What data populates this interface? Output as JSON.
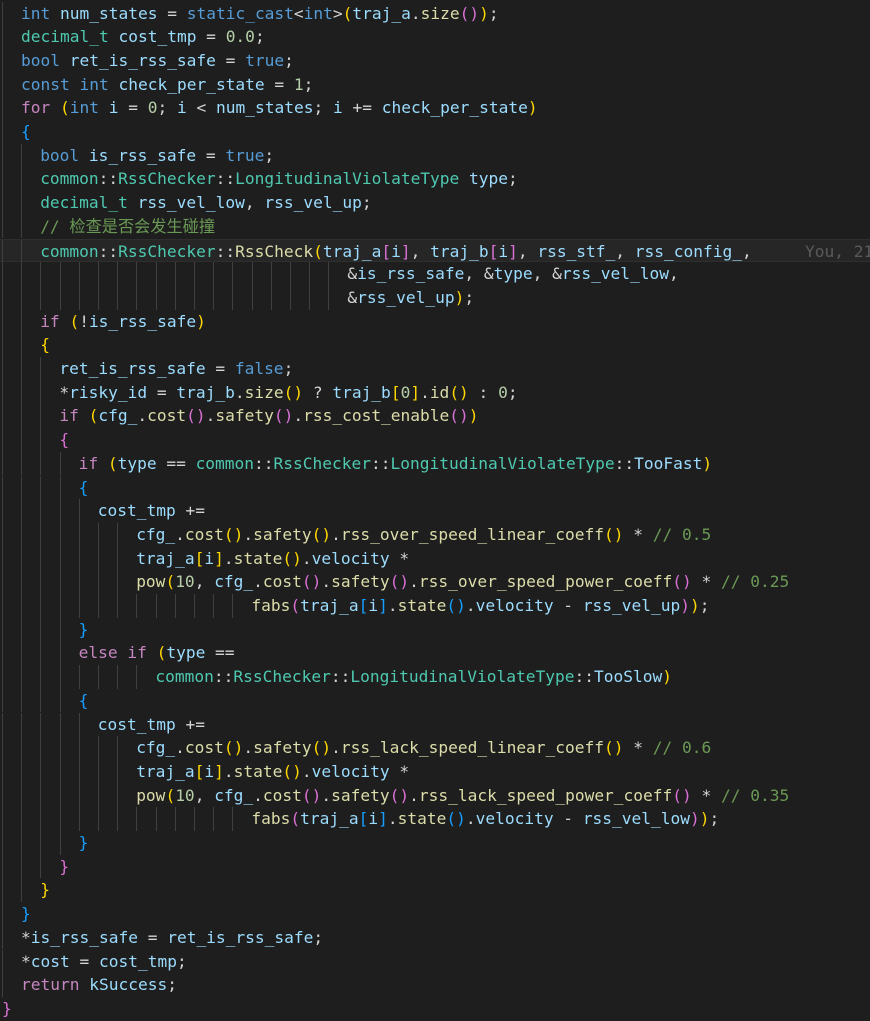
{
  "lines": [
    {
      "ind": 1,
      "t": [
        [
          "int",
          "kw"
        ],
        [
          " ",
          ""
        ],
        [
          "num_states",
          "var"
        ],
        [
          " = ",
          ""
        ],
        [
          "static_cast",
          "kw"
        ],
        [
          "<",
          "op"
        ],
        [
          "int",
          "kw"
        ],
        [
          ">",
          "op"
        ],
        [
          "(",
          "p1"
        ],
        [
          "traj_a",
          "var"
        ],
        [
          ".",
          ""
        ],
        [
          "size",
          "fn"
        ],
        [
          "()",
          "p2"
        ],
        [
          ")",
          "p1"
        ],
        [
          ";",
          ""
        ]
      ]
    },
    {
      "ind": 1,
      "t": [
        [
          "decimal_t",
          "ty"
        ],
        [
          " ",
          ""
        ],
        [
          "cost_tmp",
          "var"
        ],
        [
          " = ",
          ""
        ],
        [
          "0.0",
          "num"
        ],
        [
          ";",
          ""
        ]
      ]
    },
    {
      "ind": 1,
      "t": [
        [
          "bool",
          "kw"
        ],
        [
          " ",
          ""
        ],
        [
          "ret_is_rss_safe",
          "var"
        ],
        [
          " = ",
          ""
        ],
        [
          "true",
          "lit"
        ],
        [
          ";",
          ""
        ]
      ]
    },
    {
      "ind": 1,
      "t": [
        [
          "const",
          "kw"
        ],
        [
          " ",
          ""
        ],
        [
          "int",
          "kw"
        ],
        [
          " ",
          ""
        ],
        [
          "check_per_state",
          "var"
        ],
        [
          " = ",
          ""
        ],
        [
          "1",
          "num"
        ],
        [
          ";",
          ""
        ]
      ]
    },
    {
      "ind": 1,
      "t": [
        [
          "for",
          "ctl"
        ],
        [
          " ",
          ""
        ],
        [
          "(",
          "p1"
        ],
        [
          "int",
          "kw"
        ],
        [
          " ",
          ""
        ],
        [
          "i",
          "var"
        ],
        [
          " = ",
          ""
        ],
        [
          "0",
          "num"
        ],
        [
          "; ",
          ""
        ],
        [
          "i",
          "var"
        ],
        [
          " < ",
          ""
        ],
        [
          "num_states",
          "var"
        ],
        [
          "; ",
          ""
        ],
        [
          "i",
          "var"
        ],
        [
          " += ",
          ""
        ],
        [
          "check_per_state",
          "var"
        ],
        [
          ")",
          "p1"
        ]
      ]
    },
    {
      "ind": 1,
      "t": [
        [
          "{",
          "p3"
        ]
      ]
    },
    {
      "ind": 2,
      "t": [
        [
          "bool",
          "kw"
        ],
        [
          " ",
          ""
        ],
        [
          "is_rss_safe",
          "var"
        ],
        [
          " = ",
          ""
        ],
        [
          "true",
          "lit"
        ],
        [
          ";",
          ""
        ]
      ]
    },
    {
      "ind": 2,
      "t": [
        [
          "common",
          "ty"
        ],
        [
          "::",
          ""
        ],
        [
          "RssChecker",
          "ty"
        ],
        [
          "::",
          ""
        ],
        [
          "LongitudinalViolateType",
          "ty"
        ],
        [
          " ",
          ""
        ],
        [
          "type",
          "var"
        ],
        [
          ";",
          ""
        ]
      ]
    },
    {
      "ind": 2,
      "t": [
        [
          "decimal_t",
          "ty"
        ],
        [
          " ",
          ""
        ],
        [
          "rss_vel_low",
          "var"
        ],
        [
          ", ",
          ""
        ],
        [
          "rss_vel_up",
          "var"
        ],
        [
          ";",
          ""
        ]
      ]
    },
    {
      "ind": 2,
      "t": [
        [
          "// 检查是否会发生碰撞",
          "cm"
        ]
      ]
    },
    {
      "ind": 2,
      "current": true,
      "blame": "You, 21",
      "t": [
        [
          "common",
          "ty"
        ],
        [
          "::",
          ""
        ],
        [
          "RssChecker",
          "ty"
        ],
        [
          "::",
          ""
        ],
        [
          "RssCheck",
          "fn"
        ],
        [
          "(",
          "p1"
        ],
        [
          "traj_a",
          "var"
        ],
        [
          "[",
          "p2"
        ],
        [
          "i",
          "var"
        ],
        [
          "]",
          "p2"
        ],
        [
          ", ",
          ""
        ],
        [
          "traj_b",
          "var"
        ],
        [
          "[",
          "p2"
        ],
        [
          "i",
          "var"
        ],
        [
          "]",
          "p2"
        ],
        [
          ", ",
          ""
        ],
        [
          "rss_stf_",
          "var"
        ],
        [
          ", ",
          ""
        ],
        [
          "rss_config_",
          "var"
        ],
        [
          ",",
          ""
        ]
      ]
    },
    {
      "ind": 2,
      "cont": 16,
      "t": [
        [
          "&",
          ""
        ],
        [
          "is_rss_safe",
          "var"
        ],
        [
          ", &",
          ""
        ],
        [
          "type",
          "var"
        ],
        [
          ", &",
          ""
        ],
        [
          "rss_vel_low",
          "var"
        ],
        [
          ",",
          ""
        ]
      ]
    },
    {
      "ind": 2,
      "cont": 16,
      "t": [
        [
          "&",
          ""
        ],
        [
          "rss_vel_up",
          "var"
        ],
        [
          ")",
          "p1"
        ],
        [
          ";",
          ""
        ]
      ]
    },
    {
      "ind": 2,
      "t": [
        [
          "if",
          "ctl"
        ],
        [
          " ",
          ""
        ],
        [
          "(",
          "p1"
        ],
        [
          "!",
          ""
        ],
        [
          "is_rss_safe",
          "var"
        ],
        [
          ")",
          "p1"
        ]
      ]
    },
    {
      "ind": 2,
      "t": [
        [
          "{",
          "p1"
        ]
      ]
    },
    {
      "ind": 3,
      "t": [
        [
          "ret_is_rss_safe",
          "var"
        ],
        [
          " = ",
          ""
        ],
        [
          "false",
          "lit"
        ],
        [
          ";",
          ""
        ]
      ]
    },
    {
      "ind": 3,
      "t": [
        [
          "*",
          ""
        ],
        [
          "risky_id",
          "var"
        ],
        [
          " = ",
          ""
        ],
        [
          "traj_b",
          "var"
        ],
        [
          ".",
          ""
        ],
        [
          "size",
          "fn"
        ],
        [
          "()",
          "p1"
        ],
        [
          " ? ",
          ""
        ],
        [
          "traj_b",
          "var"
        ],
        [
          "[",
          "p1"
        ],
        [
          "0",
          "num"
        ],
        [
          "]",
          "p1"
        ],
        [
          ".",
          ""
        ],
        [
          "id",
          "fn"
        ],
        [
          "()",
          "p1"
        ],
        [
          " : ",
          ""
        ],
        [
          "0",
          "num"
        ],
        [
          ";",
          ""
        ]
      ]
    },
    {
      "ind": 3,
      "t": [
        [
          "if",
          "ctl"
        ],
        [
          " ",
          ""
        ],
        [
          "(",
          "p1"
        ],
        [
          "cfg_",
          "var"
        ],
        [
          ".",
          ""
        ],
        [
          "cost",
          "fn"
        ],
        [
          "()",
          "p2"
        ],
        [
          ".",
          ""
        ],
        [
          "safety",
          "fn"
        ],
        [
          "()",
          "p2"
        ],
        [
          ".",
          ""
        ],
        [
          "rss_cost_enable",
          "fn"
        ],
        [
          "()",
          "p2"
        ],
        [
          ")",
          "p1"
        ]
      ]
    },
    {
      "ind": 3,
      "t": [
        [
          "{",
          "p2"
        ]
      ]
    },
    {
      "ind": 4,
      "t": [
        [
          "if",
          "ctl"
        ],
        [
          " ",
          ""
        ],
        [
          "(",
          "p1"
        ],
        [
          "type",
          "var"
        ],
        [
          " == ",
          ""
        ],
        [
          "common",
          "ty"
        ],
        [
          "::",
          ""
        ],
        [
          "RssChecker",
          "ty"
        ],
        [
          "::",
          ""
        ],
        [
          "LongitudinalViolateType",
          "ty"
        ],
        [
          "::",
          ""
        ],
        [
          "TooFast",
          "var"
        ],
        [
          ")",
          "p1"
        ]
      ]
    },
    {
      "ind": 4,
      "t": [
        [
          "{",
          "p3"
        ]
      ]
    },
    {
      "ind": 5,
      "t": [
        [
          "cost_tmp",
          "var"
        ],
        [
          " +=",
          ""
        ]
      ]
    },
    {
      "ind": 5,
      "cont": 2,
      "t": [
        [
          "cfg_",
          "var"
        ],
        [
          ".",
          ""
        ],
        [
          "cost",
          "fn"
        ],
        [
          "()",
          "p1"
        ],
        [
          ".",
          ""
        ],
        [
          "safety",
          "fn"
        ],
        [
          "()",
          "p1"
        ],
        [
          ".",
          ""
        ],
        [
          "rss_over_speed_linear_coeff",
          "fn"
        ],
        [
          "()",
          "p1"
        ],
        [
          " * ",
          ""
        ],
        [
          "// 0.5",
          "cm"
        ]
      ]
    },
    {
      "ind": 5,
      "cont": 2,
      "t": [
        [
          "traj_a",
          "var"
        ],
        [
          "[",
          "p1"
        ],
        [
          "i",
          "var"
        ],
        [
          "]",
          "p1"
        ],
        [
          ".",
          ""
        ],
        [
          "state",
          "fn"
        ],
        [
          "()",
          "p1"
        ],
        [
          ".",
          ""
        ],
        [
          "velocity",
          "var"
        ],
        [
          " *",
          ""
        ]
      ]
    },
    {
      "ind": 5,
      "cont": 2,
      "t": [
        [
          "pow",
          "fn"
        ],
        [
          "(",
          "p1"
        ],
        [
          "10",
          "num"
        ],
        [
          ", ",
          ""
        ],
        [
          "cfg_",
          "var"
        ],
        [
          ".",
          ""
        ],
        [
          "cost",
          "fn"
        ],
        [
          "()",
          "p2"
        ],
        [
          ".",
          ""
        ],
        [
          "safety",
          "fn"
        ],
        [
          "()",
          "p2"
        ],
        [
          ".",
          ""
        ],
        [
          "rss_over_speed_power_coeff",
          "fn"
        ],
        [
          "()",
          "p2"
        ],
        [
          " * ",
          ""
        ],
        [
          "// 0.25",
          "cm"
        ]
      ]
    },
    {
      "ind": 5,
      "cont": 8,
      "t": [
        [
          "fabs",
          "fn"
        ],
        [
          "(",
          "p2"
        ],
        [
          "traj_a",
          "var"
        ],
        [
          "[",
          "p3"
        ],
        [
          "i",
          "var"
        ],
        [
          "]",
          "p3"
        ],
        [
          ".",
          ""
        ],
        [
          "state",
          "fn"
        ],
        [
          "()",
          "p3"
        ],
        [
          ".",
          ""
        ],
        [
          "velocity",
          "var"
        ],
        [
          " - ",
          ""
        ],
        [
          "rss_vel_up",
          "var"
        ],
        [
          ")",
          "p2"
        ],
        [
          ")",
          "p1"
        ],
        [
          ";",
          ""
        ]
      ]
    },
    {
      "ind": 4,
      "t": [
        [
          "}",
          "p3"
        ]
      ]
    },
    {
      "ind": 4,
      "t": [
        [
          "else",
          "ctl"
        ],
        [
          " ",
          ""
        ],
        [
          "if",
          "ctl"
        ],
        [
          " ",
          ""
        ],
        [
          "(",
          "p1"
        ],
        [
          "type",
          "var"
        ],
        [
          " ==",
          ""
        ]
      ]
    },
    {
      "ind": 4,
      "cont": 4,
      "t": [
        [
          "common",
          "ty"
        ],
        [
          "::",
          ""
        ],
        [
          "RssChecker",
          "ty"
        ],
        [
          "::",
          ""
        ],
        [
          "LongitudinalViolateType",
          "ty"
        ],
        [
          "::",
          ""
        ],
        [
          "TooSlow",
          "var"
        ],
        [
          ")",
          "p1"
        ]
      ]
    },
    {
      "ind": 4,
      "t": [
        [
          "{",
          "p3"
        ]
      ]
    },
    {
      "ind": 5,
      "t": [
        [
          "cost_tmp",
          "var"
        ],
        [
          " +=",
          ""
        ]
      ]
    },
    {
      "ind": 5,
      "cont": 2,
      "t": [
        [
          "cfg_",
          "var"
        ],
        [
          ".",
          ""
        ],
        [
          "cost",
          "fn"
        ],
        [
          "()",
          "p1"
        ],
        [
          ".",
          ""
        ],
        [
          "safety",
          "fn"
        ],
        [
          "()",
          "p1"
        ],
        [
          ".",
          ""
        ],
        [
          "rss_lack_speed_linear_coeff",
          "fn"
        ],
        [
          "()",
          "p1"
        ],
        [
          " * ",
          ""
        ],
        [
          "// 0.6",
          "cm"
        ]
      ]
    },
    {
      "ind": 5,
      "cont": 2,
      "t": [
        [
          "traj_a",
          "var"
        ],
        [
          "[",
          "p1"
        ],
        [
          "i",
          "var"
        ],
        [
          "]",
          "p1"
        ],
        [
          ".",
          ""
        ],
        [
          "state",
          "fn"
        ],
        [
          "()",
          "p1"
        ],
        [
          ".",
          ""
        ],
        [
          "velocity",
          "var"
        ],
        [
          " *",
          ""
        ]
      ]
    },
    {
      "ind": 5,
      "cont": 2,
      "t": [
        [
          "pow",
          "fn"
        ],
        [
          "(",
          "p1"
        ],
        [
          "10",
          "num"
        ],
        [
          ", ",
          ""
        ],
        [
          "cfg_",
          "var"
        ],
        [
          ".",
          ""
        ],
        [
          "cost",
          "fn"
        ],
        [
          "()",
          "p2"
        ],
        [
          ".",
          ""
        ],
        [
          "safety",
          "fn"
        ],
        [
          "()",
          "p2"
        ],
        [
          ".",
          ""
        ],
        [
          "rss_lack_speed_power_coeff",
          "fn"
        ],
        [
          "()",
          "p2"
        ],
        [
          " * ",
          ""
        ],
        [
          "// 0.35",
          "cm"
        ]
      ]
    },
    {
      "ind": 5,
      "cont": 8,
      "t": [
        [
          "fabs",
          "fn"
        ],
        [
          "(",
          "p2"
        ],
        [
          "traj_a",
          "var"
        ],
        [
          "[",
          "p3"
        ],
        [
          "i",
          "var"
        ],
        [
          "]",
          "p3"
        ],
        [
          ".",
          ""
        ],
        [
          "state",
          "fn"
        ],
        [
          "()",
          "p3"
        ],
        [
          ".",
          ""
        ],
        [
          "velocity",
          "var"
        ],
        [
          " - ",
          ""
        ],
        [
          "rss_vel_low",
          "var"
        ],
        [
          ")",
          "p2"
        ],
        [
          ")",
          "p1"
        ],
        [
          ";",
          ""
        ]
      ]
    },
    {
      "ind": 4,
      "t": [
        [
          "}",
          "p3"
        ]
      ]
    },
    {
      "ind": 3,
      "t": [
        [
          "}",
          "p2"
        ]
      ]
    },
    {
      "ind": 2,
      "t": [
        [
          "}",
          "p1"
        ]
      ]
    },
    {
      "ind": 1,
      "t": [
        [
          "}",
          "p3"
        ]
      ]
    },
    {
      "ind": 1,
      "t": [
        [
          "*",
          ""
        ],
        [
          "is_rss_safe",
          "var"
        ],
        [
          " = ",
          ""
        ],
        [
          "ret_is_rss_safe",
          "var"
        ],
        [
          ";",
          ""
        ]
      ]
    },
    {
      "ind": 1,
      "t": [
        [
          "*",
          ""
        ],
        [
          "cost",
          "var"
        ],
        [
          " = ",
          ""
        ],
        [
          "cost_tmp",
          "var"
        ],
        [
          ";",
          ""
        ]
      ]
    },
    {
      "ind": 1,
      "t": [
        [
          "return",
          "ctl"
        ],
        [
          " ",
          ""
        ],
        [
          "kSuccess",
          "var"
        ],
        [
          ";",
          ""
        ]
      ]
    },
    {
      "ind": 0,
      "t": [
        [
          "}",
          "p2"
        ]
      ]
    }
  ]
}
